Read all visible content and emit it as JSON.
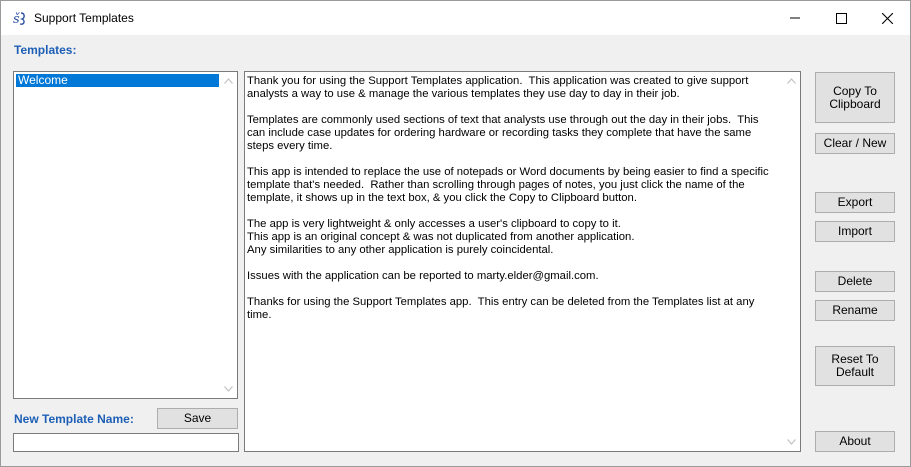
{
  "window": {
    "title": "Support Templates",
    "icons": {
      "app": "app-logo-icon",
      "minimize": "minimize-icon",
      "maximize": "maximize-icon",
      "close": "close-icon"
    }
  },
  "templates": {
    "label": "Templates:",
    "items": [
      {
        "label": "Welcome",
        "selected": true
      }
    ]
  },
  "new_template": {
    "label": "New Template Name:",
    "value": "",
    "save_label": "Save"
  },
  "editor": {
    "text": "Thank you for using the Support Templates application.  This application was created to give support analysts a way to use & manage the various templates they use day to day in their job.\n\nTemplates are commonly used sections of text that analysts use through out the day in their jobs.  This can include case updates for ordering hardware or recording tasks they complete that have the same steps every time.\n\nThis app is intended to replace the use of notepads or Word documents by being easier to find a specific template that's needed.  Rather than scrolling through pages of notes, you just click the name of the template, it shows up in the text box, & you click the Copy to Clipboard button.\n\nThe app is very lightweight & only accesses a user's clipboard to copy to it.\nThis app is an original concept & was not duplicated from another application.\nAny similarities to any other application is purely coincidental.\n\nIssues with the application can be reported to marty.elder@gmail.com.\n\nThanks for using the Support Templates app.  This entry can be deleted from the Templates list at any time."
  },
  "buttons": {
    "copy_to_clipboard": "Copy To\nClipboard",
    "clear_new": "Clear / New",
    "export": "Export",
    "import": "Import",
    "delete": "Delete",
    "rename": "Rename",
    "reset_to_default": "Reset To\nDefault",
    "about": "About"
  },
  "colors": {
    "label_blue": "#1d5fb6",
    "selection": "#0078d7",
    "button_face": "#e1e1e1"
  }
}
